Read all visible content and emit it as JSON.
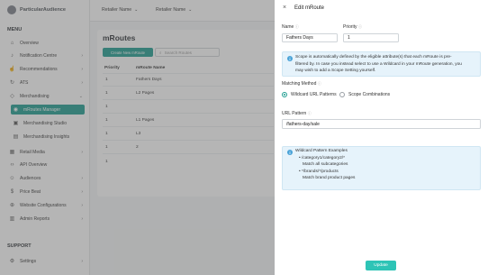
{
  "brand": {
    "name": "ParticularAudience"
  },
  "header": {
    "retailers": [
      {
        "label": "Retailer Name"
      },
      {
        "label": "Retailer Name"
      }
    ]
  },
  "sidebar": {
    "menu_heading": "MENU",
    "items": [
      {
        "label": "Overview",
        "icon": "home-icon"
      },
      {
        "label": "Notification Centre",
        "icon": "bell-icon"
      },
      {
        "label": "Recommendations",
        "icon": "thumbs-up-icon"
      },
      {
        "label": "ATS",
        "icon": "refresh-icon"
      },
      {
        "label": "Merchandising",
        "icon": "tag-icon"
      },
      {
        "label": "mRoutes Manager",
        "icon": "route-icon",
        "active": true
      },
      {
        "label": "Merchandising Studio",
        "icon": "studio-icon"
      },
      {
        "label": "Merchandising Insights",
        "icon": "chart-icon"
      },
      {
        "label": "Retail Media",
        "icon": "media-icon"
      },
      {
        "label": "API Overview",
        "icon": "code-icon"
      },
      {
        "label": "Audiences",
        "icon": "users-icon"
      },
      {
        "label": "Price Beat",
        "icon": "dollar-icon"
      },
      {
        "label": "Website Configurations",
        "icon": "globe-icon"
      },
      {
        "label": "Admin Reports",
        "icon": "report-icon"
      }
    ],
    "support_heading": "SUPPORT",
    "support_items": [
      {
        "label": "Settings",
        "icon": "gear-icon"
      }
    ]
  },
  "main": {
    "title": "mRoutes",
    "create_button": "Create New mRoute",
    "search_placeholder": "Search Routes",
    "columns": [
      "Priority",
      "mRoute Name"
    ],
    "rows": [
      {
        "priority": "1",
        "name": "Fathers Days"
      },
      {
        "priority": "1",
        "name": "L2 Pages"
      },
      {
        "priority": "1",
        "name": ""
      },
      {
        "priority": "1",
        "name": "L1 Pages"
      },
      {
        "priority": "1",
        "name": "L3"
      },
      {
        "priority": "1",
        "name": "2"
      },
      {
        "priority": "1",
        "name": ""
      }
    ]
  },
  "drawer": {
    "close_icon": "close-icon",
    "title": "Edit mRoute",
    "name_label": "Name",
    "name_value": "Fathers Days",
    "priority_label": "Priority",
    "priority_value": "1",
    "scope_info": [
      "Scope is automatically defined by the eligible attribute(s) that each mRoute is pre-",
      "filtered by. In case you instead select to use a Wildcard in your mRoute generation, you",
      "may wish to add a Scope Setting yourself."
    ],
    "matching_method_label": "Matching Method",
    "matching_options": [
      {
        "label": "Wildcard URL Patterns",
        "selected": true
      },
      {
        "label": "Scope Combinations",
        "selected": false
      }
    ],
    "url_pattern_label": "URL Pattern",
    "url_pattern_value": "/fathers-day/sale",
    "examples_title": "Wildcard Pattern Examples",
    "examples": [
      {
        "pattern": "• /category1/category2/*",
        "desc": "Match all subcategories"
      },
      {
        "pattern": "• */brands/*/products",
        "desc": "Match brand product pages"
      }
    ],
    "update_button": "Update"
  },
  "colors": {
    "accent": "#1d9c8f",
    "update": "#2ec4b6",
    "info_bg": "#e6f3fb",
    "info_icon": "#4aa3d8"
  }
}
